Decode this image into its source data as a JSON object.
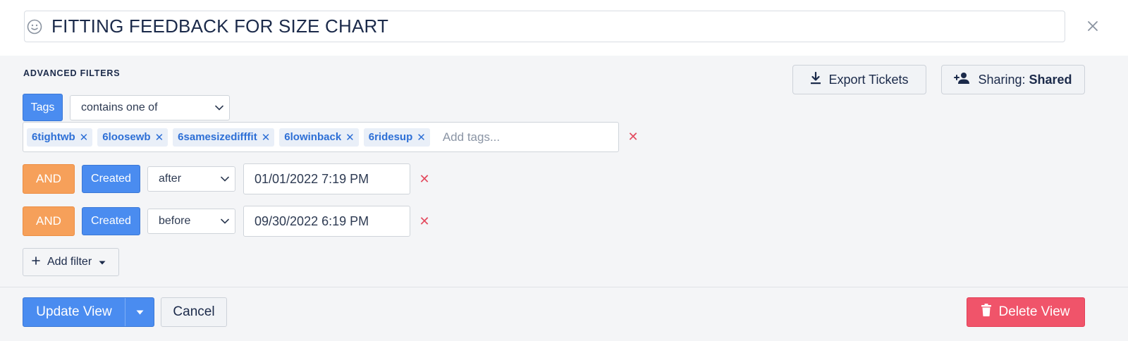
{
  "view": {
    "title": "FITTING FEEDBACK FOR SIZE CHART",
    "emoji_icon": "smiley-icon"
  },
  "filters": {
    "section_label": "ADVANCED FILTERS",
    "export_label": "Export Tickets",
    "sharing_prefix": "Sharing: ",
    "sharing_value": "Shared",
    "tags_filter": {
      "field": "Tags",
      "operator": "contains one of",
      "tags": [
        "6tightwb",
        "6loosewb",
        "6samesizedifffit",
        "6lowinback",
        "6ridesup"
      ],
      "placeholder": "Add tags..."
    },
    "date_filters": [
      {
        "conjunction": "AND",
        "field": "Created",
        "operator": "after",
        "value": "01/01/2022 7:19 PM"
      },
      {
        "conjunction": "AND",
        "field": "Created",
        "operator": "before",
        "value": "09/30/2022 6:19 PM"
      }
    ],
    "add_filter_label": "Add filter"
  },
  "footer": {
    "update_label": "Update View",
    "cancel_label": "Cancel",
    "delete_label": "Delete View"
  },
  "colors": {
    "primary": "#4a8cf0",
    "conjunction": "#f6a05a",
    "danger": "#f0546a",
    "tag_text": "#2d6fd6"
  }
}
